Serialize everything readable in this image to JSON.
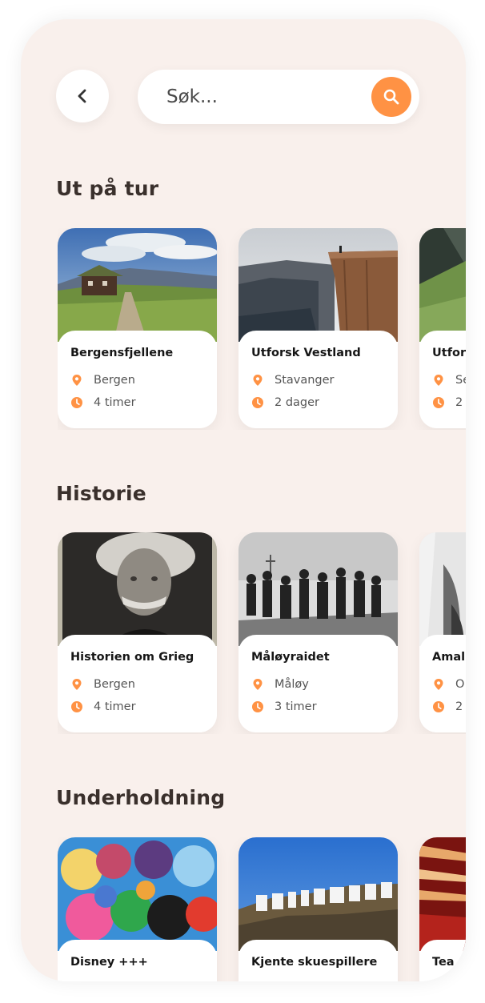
{
  "search": {
    "placeholder": "Søk..."
  },
  "icons": {
    "back": "chevron-left-icon",
    "search": "search-icon",
    "location": "location-pin-icon",
    "time": "clock-icon"
  },
  "colors": {
    "accent": "#ff9244",
    "background": "#f9f0ec",
    "card": "#ffffff",
    "title": "#3a302c"
  },
  "sections": [
    {
      "title": "Ut på tur",
      "cards": [
        {
          "title": "Bergensfjellene",
          "location": "Bergen",
          "duration": "4 timer"
        },
        {
          "title": "Utforsk Vestland",
          "location": "Stavanger",
          "duration": "2 dager"
        },
        {
          "title": "Utfors",
          "location": "Se",
          "duration": "2"
        }
      ]
    },
    {
      "title": "Historie",
      "cards": [
        {
          "title": "Historien om Grieg",
          "location": "Bergen",
          "duration": "4 timer"
        },
        {
          "title": "Måløyraidet",
          "location": "Måløy",
          "duration": "3 timer"
        },
        {
          "title": "Amali",
          "location": "O",
          "duration": "2"
        }
      ]
    },
    {
      "title": "Underholdning",
      "cards": [
        {
          "title": "Disney +++"
        },
        {
          "title": "Kjente skuespillere"
        },
        {
          "title": "Tea"
        }
      ]
    }
  ]
}
